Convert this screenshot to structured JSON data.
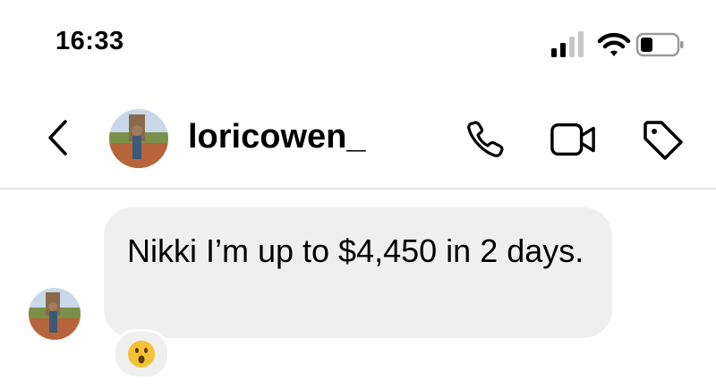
{
  "status_bar": {
    "time": "16:33",
    "signal_icon": "cellular-signal-icon",
    "wifi_icon": "wifi-icon",
    "battery_icon": "battery-icon"
  },
  "header": {
    "back_icon": "chevron-left-icon",
    "username": "loricowen_",
    "call_icon": "phone-icon",
    "video_icon": "video-camera-icon",
    "tag_icon": "tag-icon"
  },
  "messages": [
    {
      "text": "Nikki I’m up to $4,450 in 2 days.",
      "reaction_icon": "surprised-face-emoji"
    }
  ],
  "colors": {
    "bubble": "#efefef",
    "divider": "#e6e6e6",
    "emoji": "#f5c135"
  }
}
